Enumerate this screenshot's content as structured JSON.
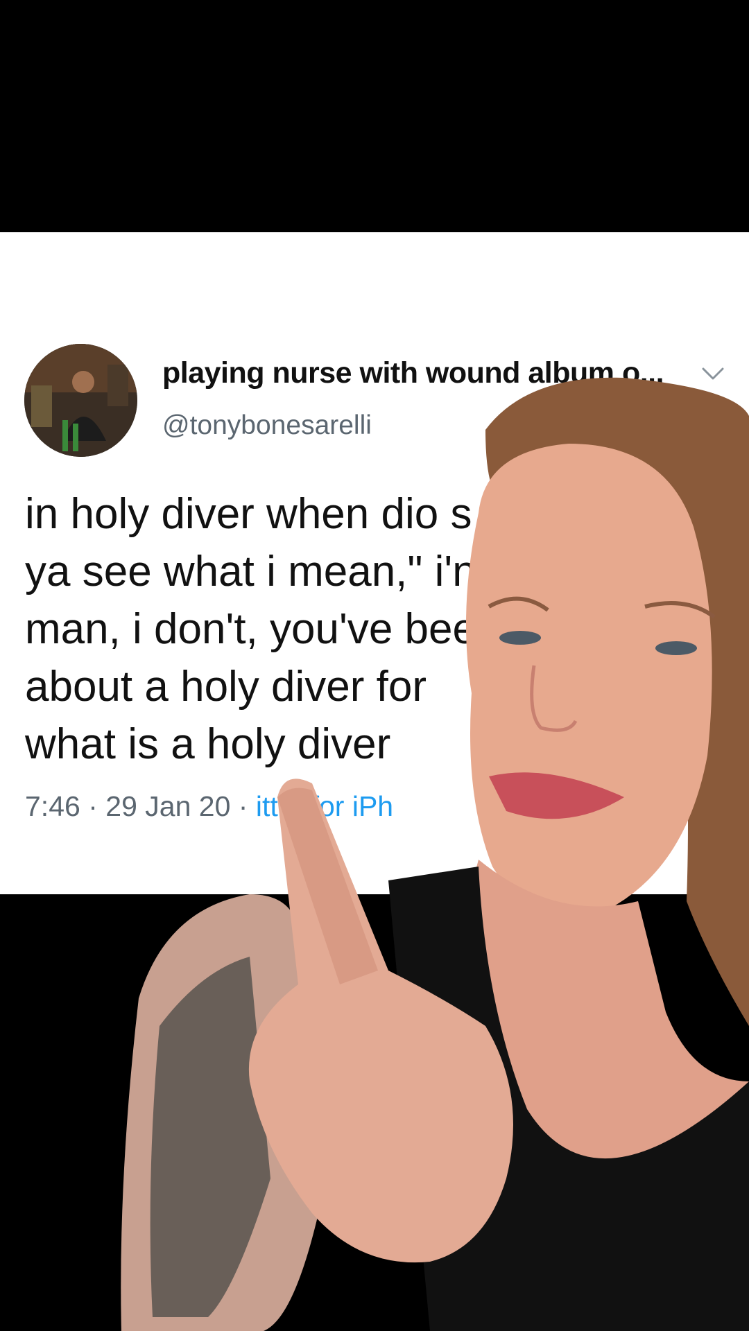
{
  "tweet": {
    "display_name": "playing nurse with wound album o...",
    "handle": "@tonybonesarelli",
    "text_lines": [
      "in holy diver when dio s",
      "ya see what i mean,\" i'n",
      "man, i don't, you've bee",
      "about a holy diver for",
      "what is a holy diver"
    ],
    "time": "7:46",
    "separator": "·",
    "date": "29 Jan 20",
    "source": "itter for iPh"
  },
  "icons": {
    "avatar": "user-avatar",
    "more": "chevron-down-icon"
  },
  "colors": {
    "card_bg": "#ffffff",
    "frame_bg": "#000000",
    "text_primary": "#111111",
    "text_secondary": "#5b6670",
    "link": "#1d9bf0"
  }
}
